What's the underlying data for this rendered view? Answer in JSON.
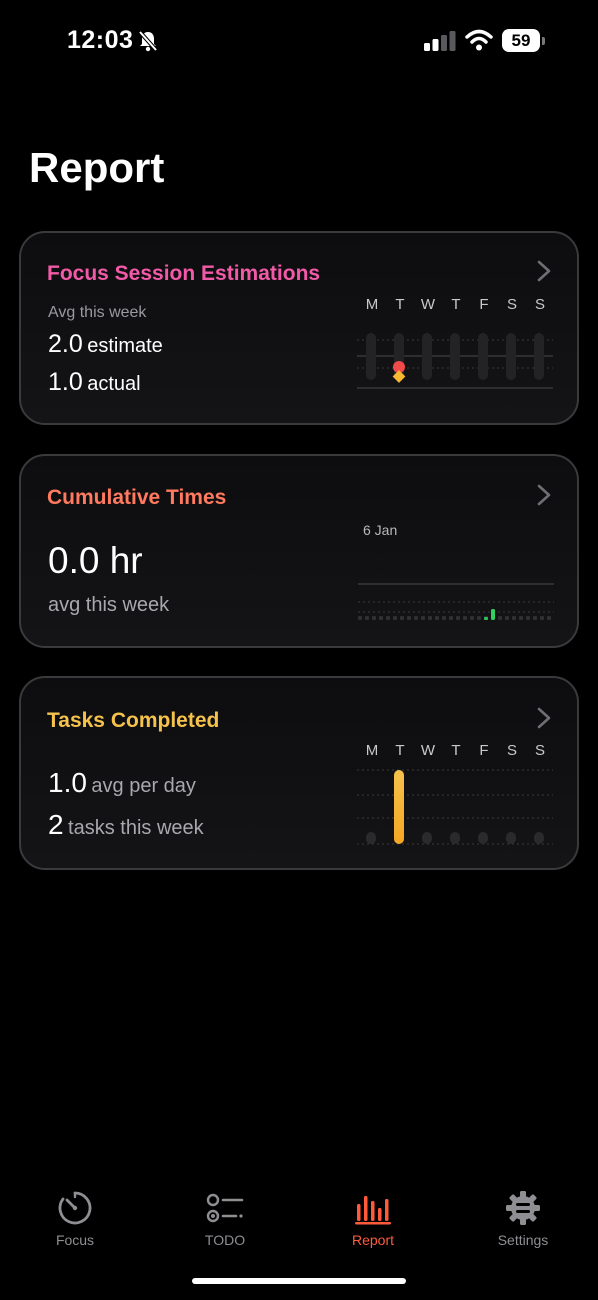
{
  "status": {
    "time": "12:03",
    "battery": "59"
  },
  "page": {
    "title": "Report"
  },
  "cards": {
    "estimations": {
      "title": "Focus Session Estimations",
      "subtitle": "Avg this week",
      "estimate_value": "2.0",
      "estimate_label": "estimate",
      "actual_value": "1.0",
      "actual_label": "actual",
      "days": [
        "M",
        "T",
        "W",
        "T",
        "F",
        "S",
        "S"
      ]
    },
    "cumulative": {
      "title": "Cumulative Times",
      "value": "0.0 hr",
      "label": "avg this week",
      "date": "6 Jan"
    },
    "tasks": {
      "title": "Tasks Completed",
      "avg_value": "1.0",
      "avg_label": "avg per day",
      "count_value": "2",
      "count_label": "tasks this week",
      "days": [
        "M",
        "T",
        "W",
        "T",
        "F",
        "S",
        "S"
      ],
      "values": [
        0,
        2,
        0,
        0,
        0,
        0,
        0
      ]
    }
  },
  "tabs": [
    {
      "label": "Focus",
      "icon": "timer-icon"
    },
    {
      "label": "TODO",
      "icon": "list-icon"
    },
    {
      "label": "Report",
      "icon": "bar-chart-icon"
    },
    {
      "label": "Settings",
      "icon": "gear-icon"
    }
  ],
  "colors": {
    "estimations_title": "#f25aa8",
    "cumulative_title": "#ff7a5e",
    "tasks_title": "#f5c24c",
    "active_tab": "#ff5b3b",
    "estimate_dot": "#f04a4a",
    "actual_dot": "#f5b830"
  }
}
